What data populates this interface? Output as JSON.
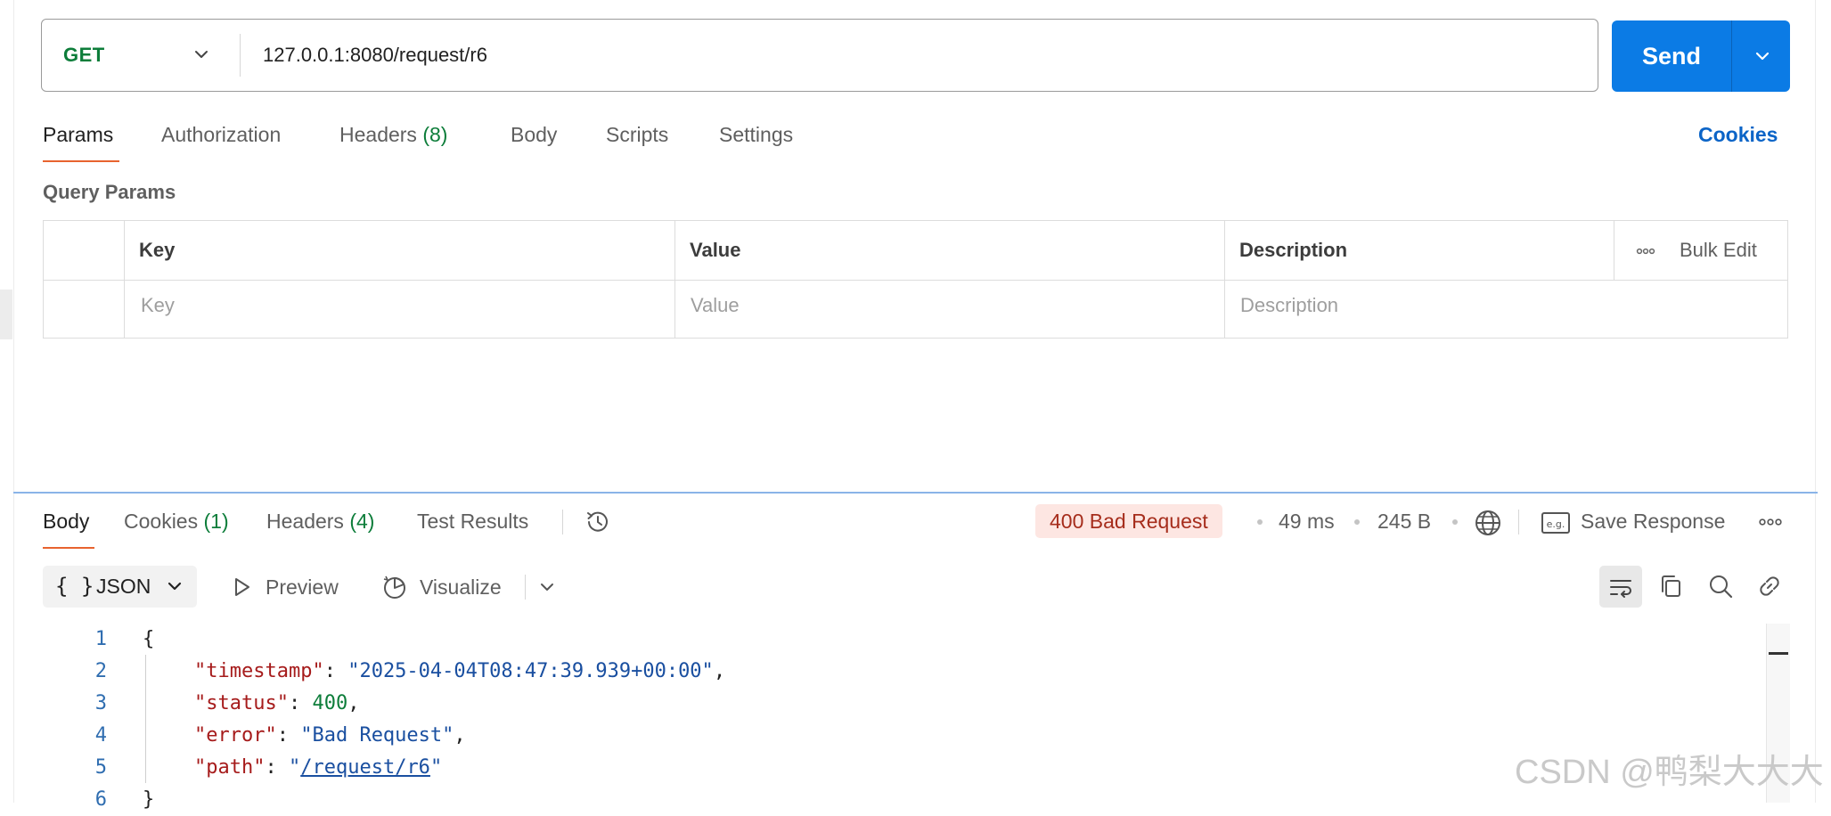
{
  "request": {
    "method": "GET",
    "url": "127.0.0.1:8080/request/r6",
    "send_label": "Send"
  },
  "request_tabs": {
    "params": "Params",
    "authorization": "Authorization",
    "headers": "Headers",
    "headers_count": "(8)",
    "body": "Body",
    "scripts": "Scripts",
    "settings": "Settings",
    "cookies": "Cookies"
  },
  "query_params": {
    "title": "Query Params",
    "headers": {
      "key": "Key",
      "value": "Value",
      "description": "Description",
      "bulk_edit": "Bulk Edit"
    },
    "placeholders": {
      "key": "Key",
      "value": "Value",
      "description": "Description"
    }
  },
  "response_tabs": {
    "body": "Body",
    "cookies": "Cookies",
    "cookies_count": "(1)",
    "headers": "Headers",
    "headers_count": "(4)",
    "test_results": "Test Results"
  },
  "response_meta": {
    "status": "400 Bad Request",
    "time": "49 ms",
    "size": "245 B",
    "save_response": "Save Response"
  },
  "response_toolbar": {
    "format": "JSON",
    "preview": "Preview",
    "visualize": "Visualize"
  },
  "code": {
    "line_numbers": [
      "1",
      "2",
      "3",
      "4",
      "5",
      "6"
    ],
    "open_brace": "{",
    "close_brace": "}",
    "timestamp_key": "\"timestamp\"",
    "timestamp_value": "\"2025-04-04T08:47:39.939+00:00\"",
    "status_key": "\"status\"",
    "status_value": "400",
    "error_key": "\"error\"",
    "error_value": "\"Bad Request\"",
    "path_key": "\"path\"",
    "path_value_open": "\"",
    "path_value_link": "/request/r6",
    "path_value_close": "\""
  },
  "watermark": "CSDN @鸭梨大大大",
  "colors": {
    "send_button": "#0b7be5",
    "method_green": "#0d7d3a",
    "active_tab_underline": "#e8632f",
    "status_badge_bg": "#fde6e2",
    "status_badge_text": "#a62d1c",
    "json_key": "#a61b1b",
    "json_string": "#1a4fa0",
    "json_number": "#0d7d3a"
  }
}
